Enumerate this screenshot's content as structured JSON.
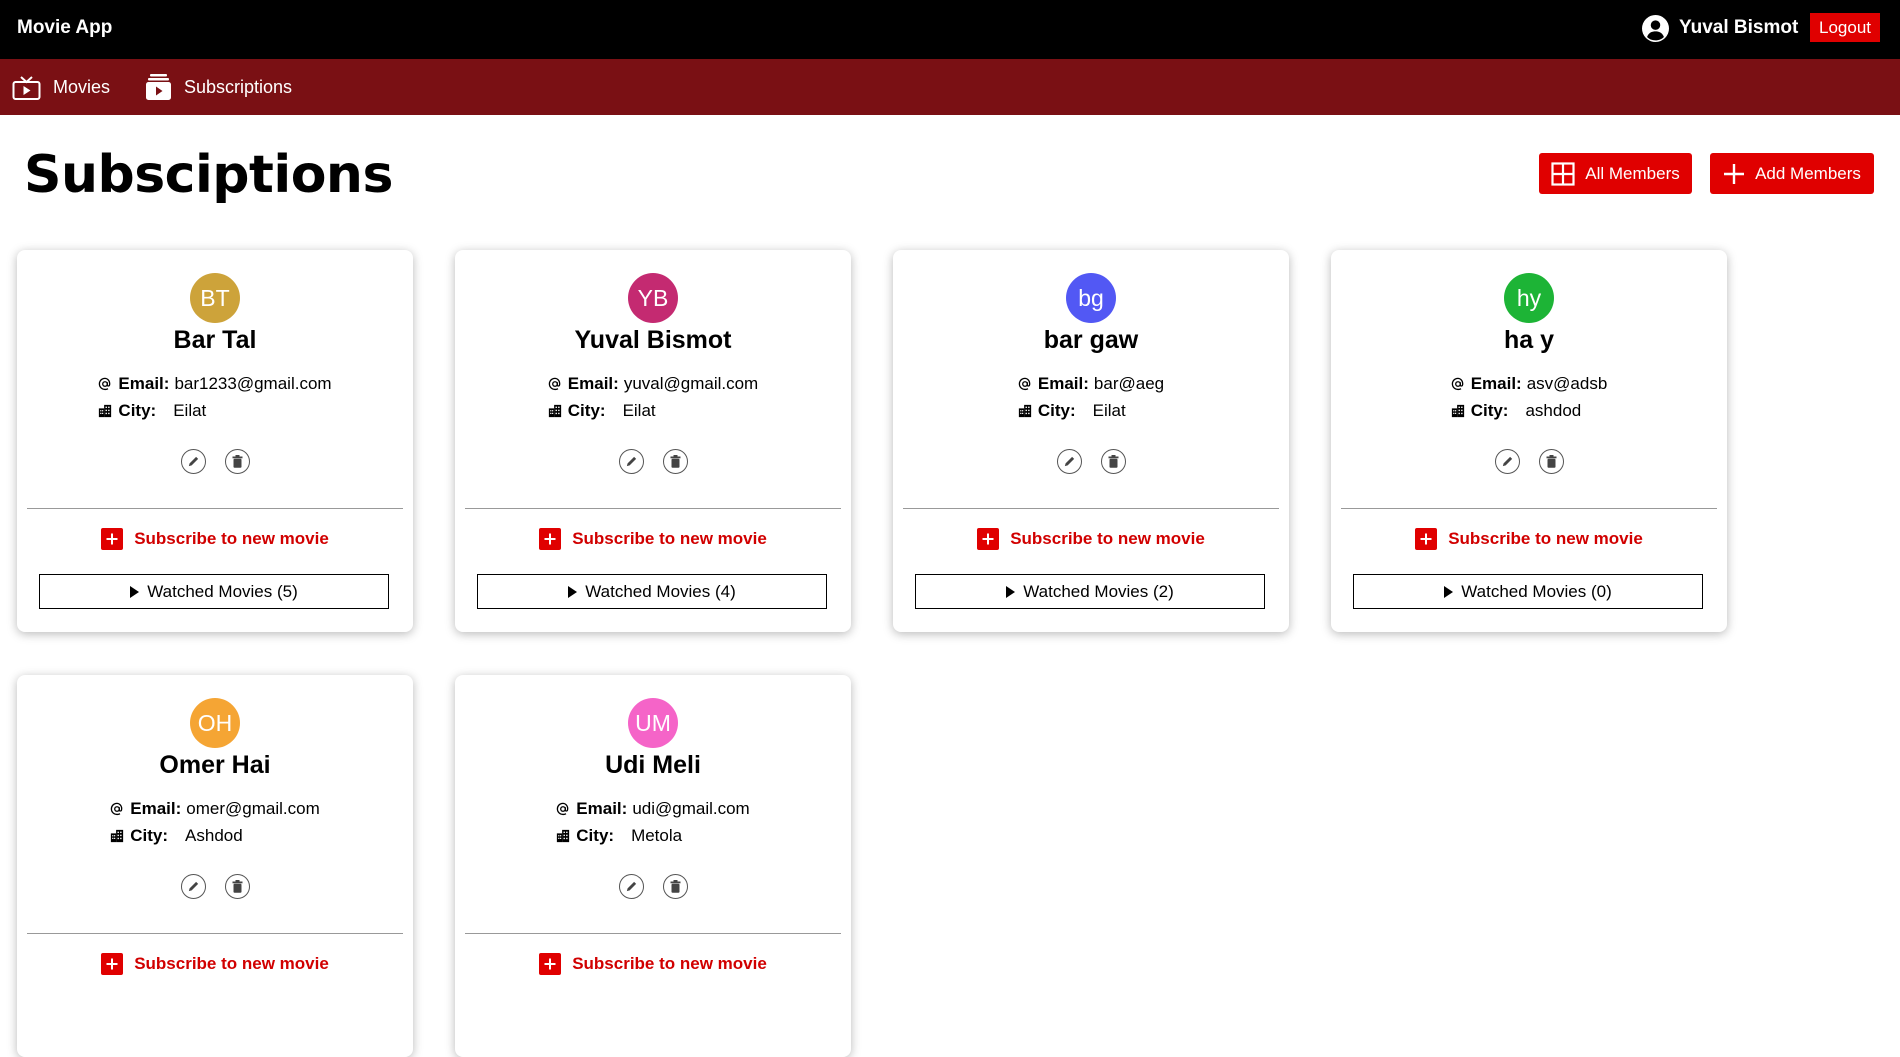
{
  "app": {
    "title": "Movie App"
  },
  "user": {
    "name": "Yuval Bismot",
    "icon": "user-circle-icon",
    "logout_label": "Logout"
  },
  "nav": {
    "items": [
      {
        "label": "Movies",
        "icon": "tv-icon"
      },
      {
        "label": "Subscriptions",
        "icon": "subscriptions-icon"
      }
    ]
  },
  "page": {
    "title": "Subsciptions",
    "all_members_label": "All Members",
    "add_members_label": "Add Members"
  },
  "labels": {
    "email": "Email:",
    "city": "City:",
    "subscribe": "Subscribe to new movie",
    "watched_prefix": "Watched Movies"
  },
  "colors": {
    "accent": "#e00000",
    "nav_bg": "#7a1014",
    "topbar_bg": "#000000"
  },
  "members": [
    {
      "initials": "BT",
      "name": "Bar Tal",
      "email": "bar1233@gmail.com",
      "city": "Eilat",
      "avatar_color": "#cda33a",
      "watched": "Watched Movies (5)"
    },
    {
      "initials": "YB",
      "name": "Yuval Bismot",
      "email": "yuval@gmail.com",
      "city": "Eilat",
      "avatar_color": "#c42a71",
      "watched": "Watched Movies (4)"
    },
    {
      "initials": "bg",
      "name": "bar gaw",
      "email": "bar@aeg",
      "city": "Eilat",
      "avatar_color": "#5258f4",
      "watched": "Watched Movies (2)"
    },
    {
      "initials": "hy",
      "name": "ha y",
      "email": "asv@adsb",
      "city": "ashdod",
      "avatar_color": "#1db436",
      "watched": "Watched Movies (0)"
    },
    {
      "initials": "OH",
      "name": "Omer Hai",
      "email": "omer@gmail.com",
      "city": "Ashdod",
      "avatar_color": "#f5a534",
      "watched": ""
    },
    {
      "initials": "UM",
      "name": "Udi Meli",
      "email": "udi@gmail.com",
      "city": "Metola",
      "avatar_color": "#f564c8",
      "watched": ""
    }
  ]
}
